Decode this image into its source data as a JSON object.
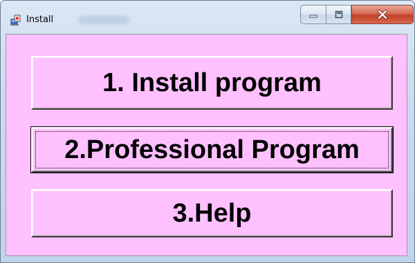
{
  "window": {
    "title": "Install",
    "icon": "installer-icon"
  },
  "caption_buttons": {
    "minimize_icon": "minimize-icon",
    "maximize_icon": "maximize-icon",
    "close_icon": "close-icon"
  },
  "colors": {
    "client_background": "#ffc0ff",
    "button_face": "#ffc0ff",
    "close_button": "#c2412a"
  },
  "menu": {
    "buttons": [
      {
        "label": "1. Install program"
      },
      {
        "label": "2.Professional Program",
        "focused": true
      },
      {
        "label": "3.Help"
      }
    ]
  }
}
